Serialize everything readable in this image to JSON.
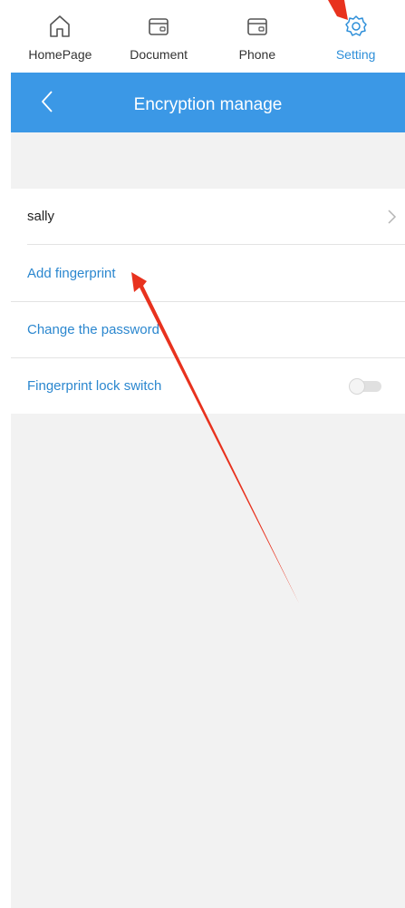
{
  "tabs": [
    {
      "label": "HomePage",
      "icon": "home-icon",
      "active": false
    },
    {
      "label": "Document",
      "icon": "document-icon",
      "active": false
    },
    {
      "label": "Phone",
      "icon": "phone-icon",
      "active": false
    },
    {
      "label": "Setting",
      "icon": "gear-icon",
      "active": true
    }
  ],
  "header": {
    "title": "Encryption manage",
    "back_icon": "back-chevron-icon"
  },
  "list": {
    "user": {
      "label": "sally",
      "icon": "chevron-right-icon"
    },
    "add_fingerprint": {
      "label": "Add fingerprint"
    },
    "change_password": {
      "label": "Change the password"
    },
    "fingerprint_lock": {
      "label": "Fingerprint lock switch",
      "enabled": false
    }
  },
  "colors": {
    "accent": "#3b98e6",
    "link": "#2b87cf",
    "background": "#f2f2f2",
    "annotation_arrow": "#e8321e"
  }
}
